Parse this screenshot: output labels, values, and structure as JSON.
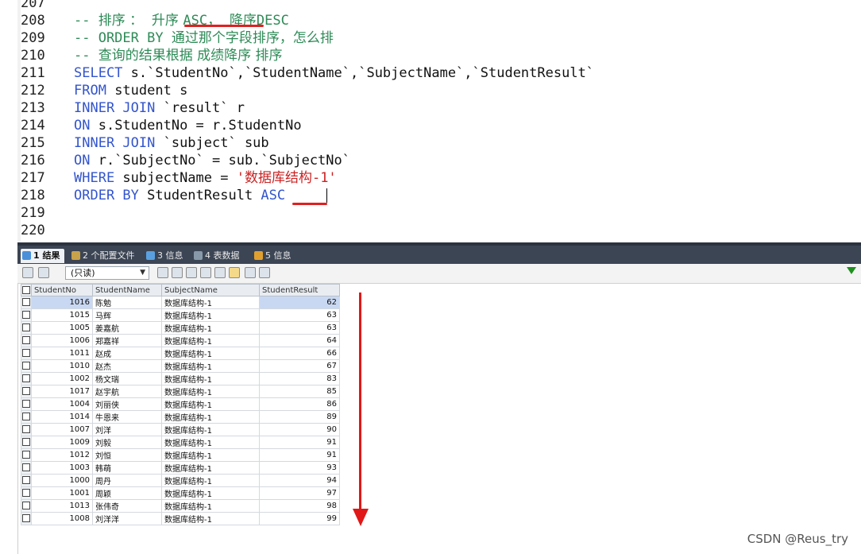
{
  "editor": {
    "lines": [
      {
        "num": "207",
        "segments": []
      },
      {
        "num": "208",
        "segments": [
          {
            "cls": "cm",
            "text": "-- "
          },
          {
            "cls": "cm-cn",
            "text": "排序 ：  升序 "
          },
          {
            "cls": "cm",
            "text": "ASC"
          },
          {
            "cls": "cm-cn",
            "text": "，  降序"
          },
          {
            "cls": "cm",
            "text": "DESC"
          }
        ]
      },
      {
        "num": "209",
        "segments": [
          {
            "cls": "cm",
            "text": "-- ORDER BY "
          },
          {
            "cls": "cm-cn",
            "text": "通过那个字段排序，怎么排"
          }
        ]
      },
      {
        "num": "210",
        "segments": [
          {
            "cls": "cm",
            "text": "-- "
          },
          {
            "cls": "cm-cn",
            "text": "查询的结果根据 成绩降序 排序"
          }
        ]
      },
      {
        "num": "211",
        "segments": [
          {
            "cls": "kw",
            "text": "SELECT "
          },
          {
            "cls": "tx",
            "text": "s.`StudentNo`,`StudentName`,`SubjectName`,`StudentResult`"
          }
        ]
      },
      {
        "num": "212",
        "segments": [
          {
            "cls": "kw",
            "text": "FROM "
          },
          {
            "cls": "tx",
            "text": "student s"
          }
        ]
      },
      {
        "num": "213",
        "segments": [
          {
            "cls": "kw",
            "text": "INNER JOIN "
          },
          {
            "cls": "tx",
            "text": "`result` r"
          }
        ]
      },
      {
        "num": "214",
        "segments": [
          {
            "cls": "kw",
            "text": "ON "
          },
          {
            "cls": "tx",
            "text": "s.StudentNo = r.StudentNo"
          }
        ]
      },
      {
        "num": "215",
        "segments": [
          {
            "cls": "kw",
            "text": "INNER JOIN "
          },
          {
            "cls": "tx",
            "text": "`subject` sub"
          }
        ]
      },
      {
        "num": "216",
        "segments": [
          {
            "cls": "kw",
            "text": "ON "
          },
          {
            "cls": "tx",
            "text": "r.`SubjectNo` = sub.`SubjectNo`"
          }
        ]
      },
      {
        "num": "217",
        "segments": [
          {
            "cls": "kw",
            "text": "WHERE "
          },
          {
            "cls": "tx",
            "text": "subjectName = "
          },
          {
            "cls": "st",
            "text": "'数据库结构-1'"
          }
        ]
      },
      {
        "num": "218",
        "segments": [
          {
            "cls": "kw",
            "text": "ORDER BY "
          },
          {
            "cls": "tx",
            "text": "StudentResult "
          },
          {
            "cls": "kw",
            "text": "ASC"
          }
        ]
      },
      {
        "num": "219",
        "segments": []
      },
      {
        "num": "220",
        "segments": []
      }
    ]
  },
  "tabs": [
    {
      "label": "1 结果",
      "active": true,
      "color": "#4a90d9"
    },
    {
      "label": "2 个配置文件",
      "active": false,
      "color": "#c9a34a"
    },
    {
      "label": "3 信息",
      "active": false,
      "color": "#5aa0e0"
    },
    {
      "label": "4 表数据",
      "active": false,
      "color": "#8899aa"
    },
    {
      "label": "5 信息",
      "active": false,
      "color": "#e0a030"
    }
  ],
  "toolbar": {
    "mode_label": "(只读)"
  },
  "grid": {
    "columns": [
      "StudentNo",
      "StudentName",
      "SubjectName",
      "StudentResult"
    ],
    "rows": [
      [
        "1016",
        "陈勉",
        "数据库结构-1",
        "62"
      ],
      [
        "1015",
        "马辉",
        "数据库结构-1",
        "63"
      ],
      [
        "1005",
        "姜嘉航",
        "数据库结构-1",
        "63"
      ],
      [
        "1006",
        "郑嘉祥",
        "数据库结构-1",
        "64"
      ],
      [
        "1011",
        "赵成",
        "数据库结构-1",
        "66"
      ],
      [
        "1010",
        "赵杰",
        "数据库结构-1",
        "67"
      ],
      [
        "1002",
        "杨文瑞",
        "数据库结构-1",
        "83"
      ],
      [
        "1017",
        "赵宇航",
        "数据库结构-1",
        "85"
      ],
      [
        "1004",
        "刘丽侠",
        "数据库结构-1",
        "86"
      ],
      [
        "1014",
        "牛恩来",
        "数据库结构-1",
        "89"
      ],
      [
        "1007",
        "刘洋",
        "数据库结构-1",
        "90"
      ],
      [
        "1009",
        "刘毅",
        "数据库结构-1",
        "91"
      ],
      [
        "1012",
        "刘恒",
        "数据库结构-1",
        "91"
      ],
      [
        "1003",
        "韩萌",
        "数据库结构-1",
        "93"
      ],
      [
        "1000",
        "周丹",
        "数据库结构-1",
        "94"
      ],
      [
        "1001",
        "周颖",
        "数据库结构-1",
        "97"
      ],
      [
        "1013",
        "张伟奇",
        "数据库结构-1",
        "98"
      ],
      [
        "1008",
        "刘洋洋",
        "数据库结构-1",
        "99"
      ]
    ]
  },
  "watermark": "CSDN @Reus_try",
  "colors": {
    "annotation": "#e01818"
  }
}
